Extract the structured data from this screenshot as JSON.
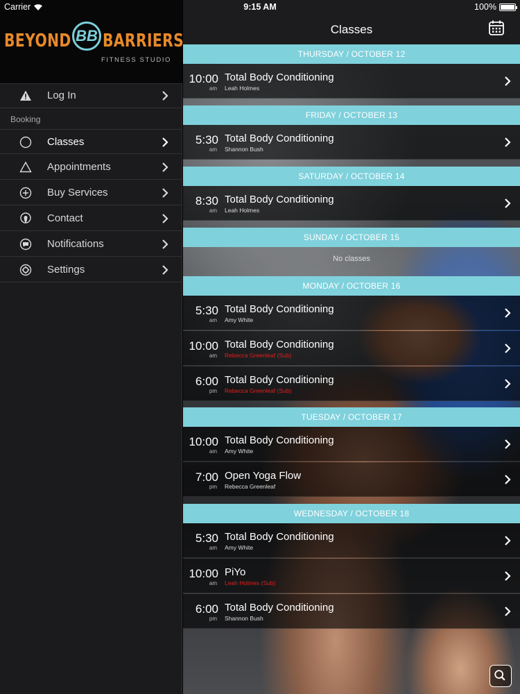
{
  "status_bar": {
    "carrier": "Carrier",
    "time": "9:15 AM",
    "battery": "100%"
  },
  "logo": {
    "word_left": "BEYOND",
    "monogram": "BB",
    "word_right": "BARRIERS",
    "subtitle": "FITNESS STUDIO"
  },
  "sidebar": {
    "login": "Log In",
    "section": "Booking",
    "items": [
      {
        "label": "Classes",
        "icon": "circle-icon"
      },
      {
        "label": "Appointments",
        "icon": "triangle-icon"
      },
      {
        "label": "Buy Services",
        "icon": "plus-circle-icon"
      },
      {
        "label": "Contact",
        "icon": "location-pin-icon"
      },
      {
        "label": "Notifications",
        "icon": "chat-bubble-icon"
      },
      {
        "label": "Settings",
        "icon": "gear-icon"
      }
    ]
  },
  "navbar": {
    "title": "Classes"
  },
  "colors": {
    "accent": "#7fd1dc",
    "sub_instructor": "#e02020",
    "sidebar_bg": "#1b1b1d"
  },
  "schedule": [
    {
      "day": "THURSDAY / OCTOBER 12",
      "classes": [
        {
          "time": "10:00",
          "ampm": "am",
          "name": "Total Body Conditioning",
          "instructor": "Leah Holmes",
          "sub": false
        }
      ]
    },
    {
      "day": "FRIDAY / OCTOBER 13",
      "classes": [
        {
          "time": "5:30",
          "ampm": "am",
          "name": "Total Body Conditioning",
          "instructor": "Shannon Bush",
          "sub": false
        }
      ]
    },
    {
      "day": "SATURDAY / OCTOBER 14",
      "classes": [
        {
          "time": "8:30",
          "ampm": "am",
          "name": "Total Body Conditioning",
          "instructor": "Leah Holmes",
          "sub": false
        }
      ]
    },
    {
      "day": "SUNDAY / OCTOBER 15",
      "empty_text": "No classes",
      "classes": []
    },
    {
      "day": "MONDAY / OCTOBER 16",
      "classes": [
        {
          "time": "5:30",
          "ampm": "am",
          "name": "Total Body Conditioning",
          "instructor": "Amy White",
          "sub": false
        },
        {
          "time": "10:00",
          "ampm": "am",
          "name": "Total Body Conditioning",
          "instructor": "Rebecca Greenleaf (Sub)",
          "sub": true
        },
        {
          "time": "6:00",
          "ampm": "pm",
          "name": "Total Body Conditioning",
          "instructor": "Rebecca Greenleaf (Sub)",
          "sub": true
        }
      ]
    },
    {
      "day": "TUESDAY / OCTOBER 17",
      "classes": [
        {
          "time": "10:00",
          "ampm": "am",
          "name": "Total Body Conditioning",
          "instructor": "Amy White",
          "sub": false
        },
        {
          "time": "7:00",
          "ampm": "pm",
          "name": "Open Yoga Flow",
          "instructor": "Rebecca Greenleaf",
          "sub": false
        }
      ]
    },
    {
      "day": "WEDNESDAY / OCTOBER 18",
      "classes": [
        {
          "time": "5:30",
          "ampm": "am",
          "name": "Total Body Conditioning",
          "instructor": "Amy White",
          "sub": false
        },
        {
          "time": "10:00",
          "ampm": "am",
          "name": "PiYo",
          "instructor": "Leah Holmes (Sub)",
          "sub": true
        },
        {
          "time": "6:00",
          "ampm": "pm",
          "name": "Total Body Conditioning",
          "instructor": "Shannon Bush",
          "sub": false
        }
      ]
    }
  ]
}
